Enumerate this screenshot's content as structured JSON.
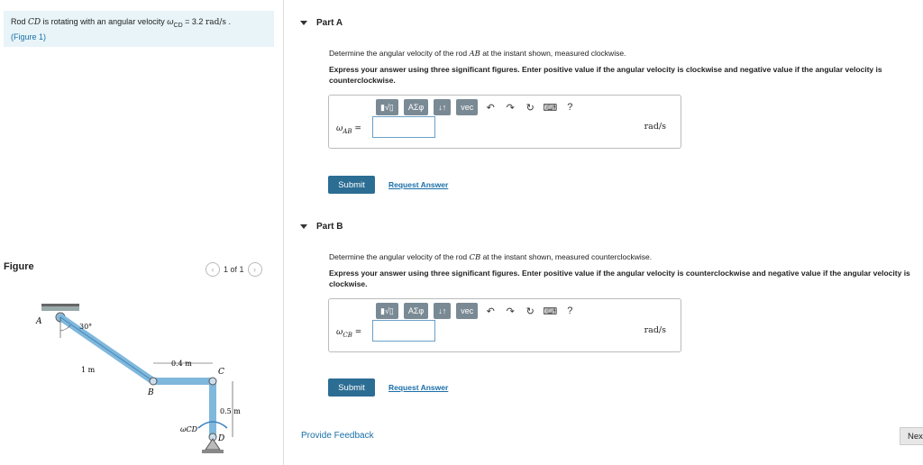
{
  "problem": {
    "text_prefix": "Rod ",
    "rod_name": "CD",
    "text_mid": " is rotating with an angular velocity ",
    "omega_symbol": "ω",
    "omega_sub": "CD",
    "value": " = 3.2 ",
    "unit": "rad/s",
    "period": " .",
    "figure_link": "(Figure 1)"
  },
  "figure": {
    "title": "Figure",
    "pager": "1 of 1",
    "prev_icon": "chevron-left-icon",
    "next_icon": "chevron-right-icon",
    "labels": {
      "A": "A",
      "B": "B",
      "C": "C",
      "D": "D",
      "angle": "30°",
      "len_ab": "1 m",
      "len_bc": "0.4 m",
      "len_cd": "0.5 m",
      "omega": "ωCD"
    }
  },
  "parts": [
    {
      "title": "Part A",
      "prompt_prefix": "Determine the angular velocity of the rod ",
      "rod": "AB",
      "prompt_suffix": " at the instant shown, measured clockwise.",
      "instruction": "Express your answer using three significant figures. Enter positive value if the angular velocity is clockwise and negative value if the angular velocity is counterclockwise.",
      "var_omega": "ω",
      "var_sub": "AB",
      "equals": " =",
      "unit": "rad/s",
      "submit": "Submit",
      "request": "Request Answer"
    },
    {
      "title": "Part B",
      "prompt_prefix": "Determine the angular velocity of the rod ",
      "rod": "CB",
      "prompt_suffix": " at the instant shown, measured counterclockwise.",
      "instruction": "Express your answer using three significant figures. Enter positive value if the angular velocity is counterclockwise and negative value if the angular velocity is clockwise.",
      "var_omega": "ω",
      "var_sub": "CB",
      "equals": " =",
      "unit": "rad/s",
      "submit": "Submit",
      "request": "Request Answer"
    }
  ],
  "toolbar": {
    "greek": "ΑΣφ",
    "sort": "↓↑",
    "vec": "vec",
    "help": "?"
  },
  "feedback": "Provide Feedback",
  "next": "Nex"
}
